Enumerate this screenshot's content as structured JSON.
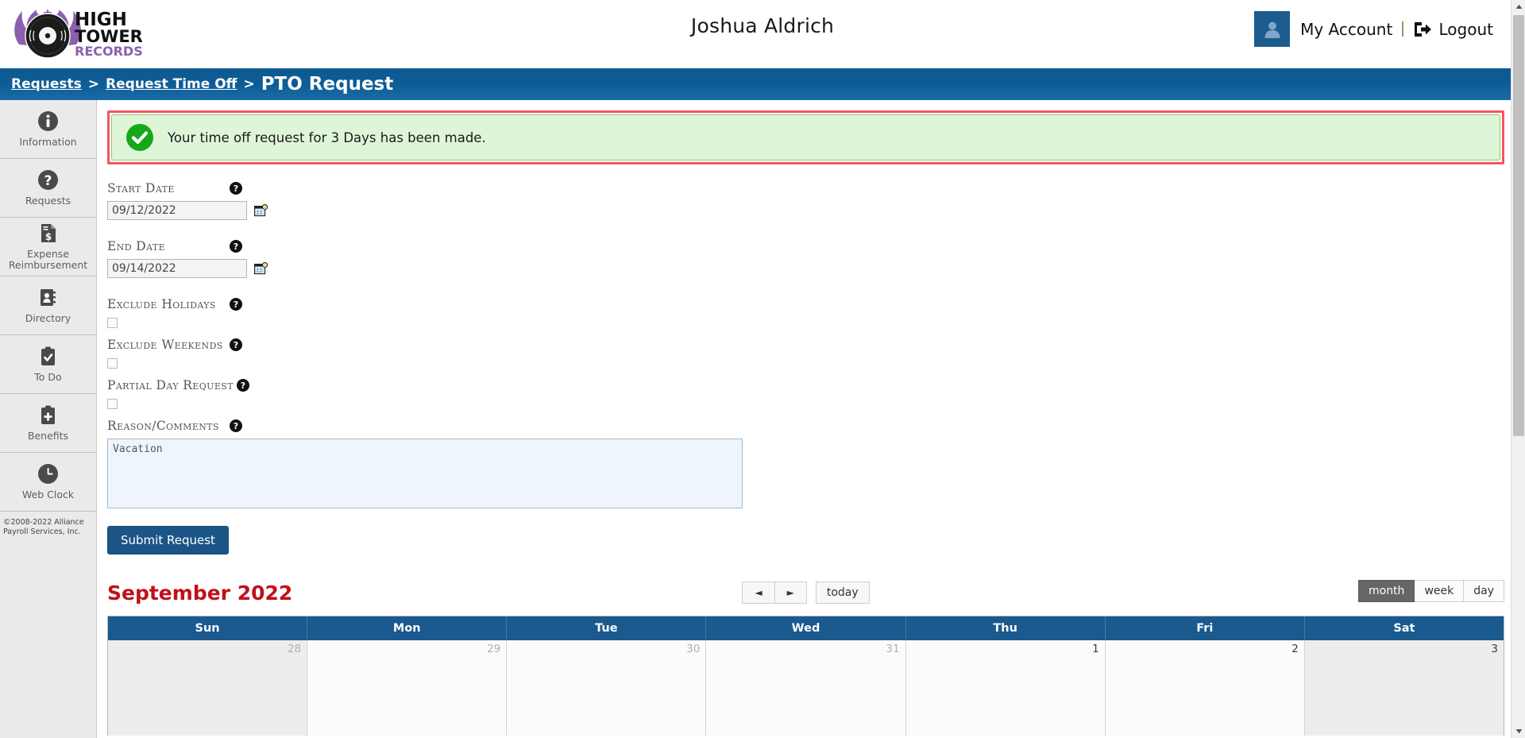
{
  "header": {
    "logo_line1": "HIGH",
    "logo_line2": "TOWER",
    "logo_line3": "RECORDS",
    "user_name": "Joshua Aldrich",
    "my_account_label": "My Account",
    "separator": "|",
    "logout_label": "Logout"
  },
  "breadcrumb": {
    "item1": "Requests",
    "sep1": ">",
    "item2": "Request Time Off",
    "sep2": ">",
    "current": "PTO Request"
  },
  "sidebar": {
    "items": [
      {
        "label": "Information",
        "icon": "info-circle-icon"
      },
      {
        "label": "Requests",
        "icon": "question-circle-icon"
      },
      {
        "label": "Expense Reimbursement",
        "icon": "receipt-dollar-icon"
      },
      {
        "label": "Directory",
        "icon": "address-book-icon"
      },
      {
        "label": "To Do",
        "icon": "clipboard-check-icon"
      },
      {
        "label": "Benefits",
        "icon": "clipboard-medical-icon"
      },
      {
        "label": "Web Clock",
        "icon": "clock-icon"
      }
    ],
    "copyright": "©2008-2022 Alliance Payroll Services, Inc."
  },
  "alert": {
    "message": "Your time off request for 3 Days has been made.",
    "icon": "check-circle-icon",
    "bg_color": "#dff5d8",
    "border_color": "#8fc47f",
    "highlight_color": "#f4565b"
  },
  "form": {
    "start_date": {
      "label": "Start Date",
      "value": "09/12/2022",
      "help_icon": "question-circle-icon",
      "calendar_icon": "calendar-picker-icon"
    },
    "end_date": {
      "label": "End Date",
      "value": "09/14/2022",
      "help_icon": "question-circle-icon",
      "calendar_icon": "calendar-picker-icon"
    },
    "exclude_holidays": {
      "label": "Exclude Holidays",
      "checked": false
    },
    "exclude_weekends": {
      "label": "Exclude Weekends",
      "checked": false
    },
    "partial_day": {
      "label": "Partial Day Request",
      "checked": false
    },
    "reason": {
      "label": "Reason/Comments",
      "value": "Vacation",
      "placeholder": ""
    },
    "submit_label": "Submit Request"
  },
  "calendar": {
    "title": "September 2022",
    "title_color": "#c0111b",
    "prev_label": "◄",
    "next_label": "►",
    "today_label": "today",
    "views": [
      {
        "label": "month",
        "active": true
      },
      {
        "label": "week",
        "active": false
      },
      {
        "label": "day",
        "active": false
      }
    ],
    "day_headers": [
      "Sun",
      "Mon",
      "Tue",
      "Wed",
      "Thu",
      "Fri",
      "Sat"
    ],
    "weeks": [
      [
        {
          "day": "28",
          "other_month": true,
          "weekend": true
        },
        {
          "day": "29",
          "other_month": true,
          "weekend": false
        },
        {
          "day": "30",
          "other_month": true,
          "weekend": false
        },
        {
          "day": "31",
          "other_month": true,
          "weekend": false
        },
        {
          "day": "1",
          "other_month": false,
          "weekend": false
        },
        {
          "day": "2",
          "other_month": false,
          "weekend": false
        },
        {
          "day": "3",
          "other_month": false,
          "weekend": true
        }
      ]
    ]
  },
  "theme": {
    "primary_blue": "#1b5a8e",
    "breadcrumb_blue": "#0d5a92",
    "accent_purple": "#8a5fb0",
    "button_blue": "#1b5585"
  }
}
